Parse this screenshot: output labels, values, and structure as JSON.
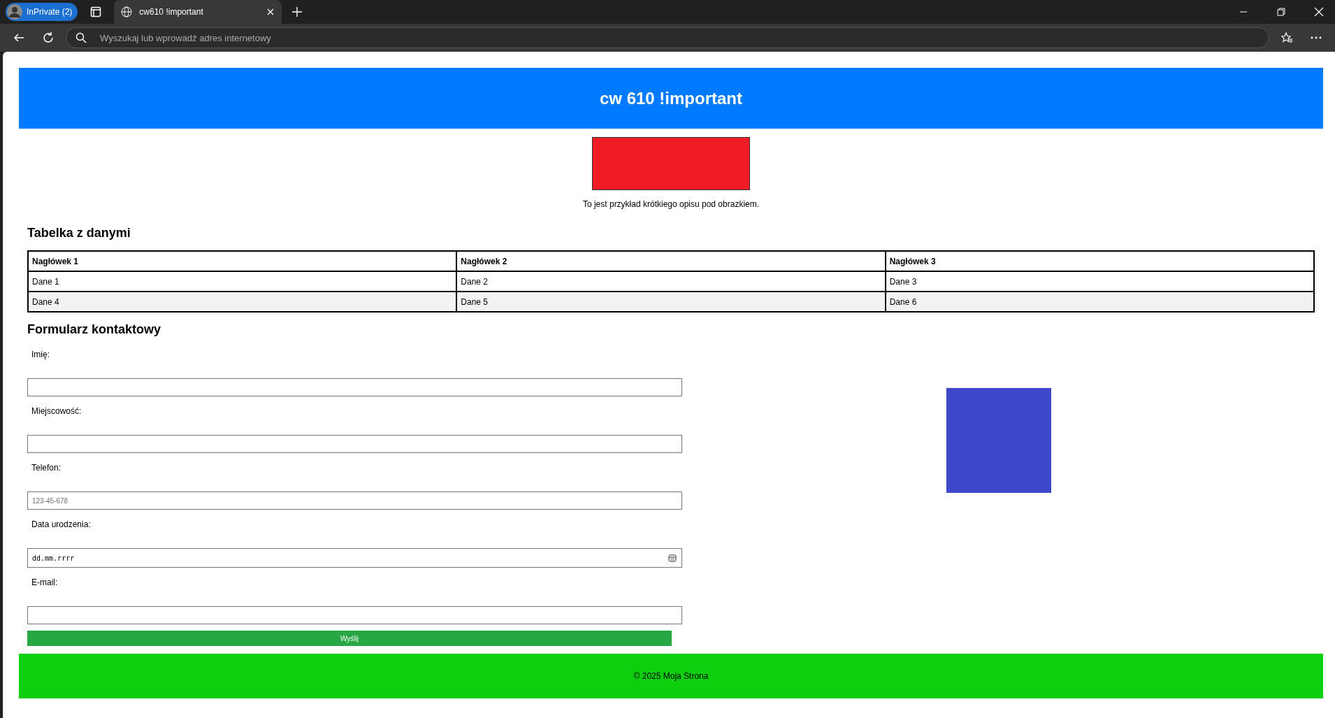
{
  "browser": {
    "profile": "InPrivate (2)",
    "tabs": [
      {
        "title": "cw610 !important",
        "selected": true
      }
    ],
    "address_placeholder": "Wyszukaj lub wprowadź adres internetowy"
  },
  "header": {
    "title": "cw 610 !important"
  },
  "figure": {
    "caption": "To jest przykład krótkiego opisu pod obrazkiem."
  },
  "table_section": {
    "title": "Tabelka z danymi"
  },
  "table": {
    "columns": [
      "Nagłówek 1",
      "Nagłówek 2",
      "Nagłówek 3"
    ],
    "rows": [
      [
        "Dane 1",
        "Dane 2",
        "Dane 3"
      ],
      [
        "Dane 4",
        "Dane 5",
        "Dane 6"
      ]
    ]
  },
  "form": {
    "title": "Formularz kontaktowy",
    "fields": [
      {
        "label": "Imię:",
        "kind": "text"
      },
      {
        "label": "Miejscowość:",
        "kind": "text"
      },
      {
        "label": "Telefon:",
        "kind": "text",
        "placeholder": "123-45-678"
      },
      {
        "label": "Data urodzenia:",
        "kind": "date",
        "placeholder": "dd.mm.rrrr"
      },
      {
        "label": "E-mail:",
        "kind": "text"
      }
    ],
    "submit": "Wyślij"
  },
  "footer": {
    "text": "© 2025 Moja Strona"
  }
}
